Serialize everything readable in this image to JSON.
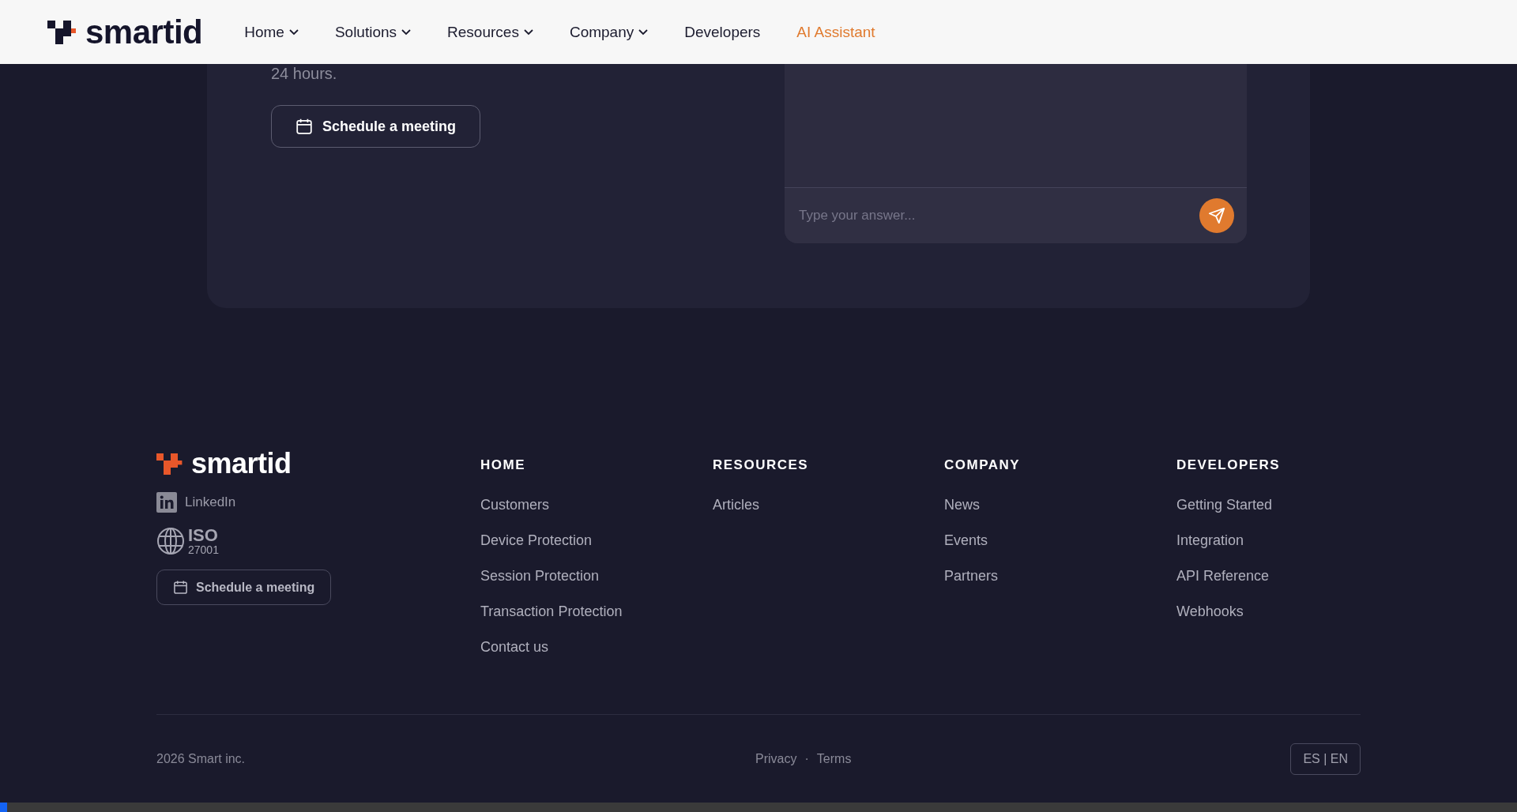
{
  "header": {
    "logo": "smartid",
    "nav": [
      {
        "label": "Home",
        "dropdown": true,
        "highlighted": false
      },
      {
        "label": "Solutions",
        "dropdown": true,
        "highlighted": false
      },
      {
        "label": "Resources",
        "dropdown": true,
        "highlighted": false
      },
      {
        "label": "Company",
        "dropdown": true,
        "highlighted": false
      },
      {
        "label": "Developers",
        "dropdown": false,
        "highlighted": false
      },
      {
        "label": "AI Assistant",
        "dropdown": false,
        "highlighted": true
      }
    ]
  },
  "contact": {
    "text": "24 hours.",
    "button": "Schedule a meeting",
    "chat": {
      "placeholder": "Type your answer..."
    }
  },
  "footer": {
    "logo": "smartid",
    "linkedin": "LinkedIn",
    "iso": {
      "title": "ISO",
      "number": "27001"
    },
    "button": "Schedule a meeting",
    "columns": [
      {
        "heading": "HOME",
        "links": [
          "Customers",
          "Device Protection",
          "Session Protection",
          "Transaction Protection",
          "Contact us"
        ]
      },
      {
        "heading": "RESOURCES",
        "links": [
          "Articles"
        ]
      },
      {
        "heading": "COMPANY",
        "links": [
          "News",
          "Events",
          "Partners"
        ]
      },
      {
        "heading": "DEVELOPERS",
        "links": [
          "Getting Started",
          "Integration",
          "API Reference",
          "Webhooks"
        ]
      }
    ],
    "copyright": "2026 Smart inc.",
    "legal": [
      "Privacy",
      "Terms"
    ],
    "separator": "·",
    "language": "ES | EN"
  }
}
